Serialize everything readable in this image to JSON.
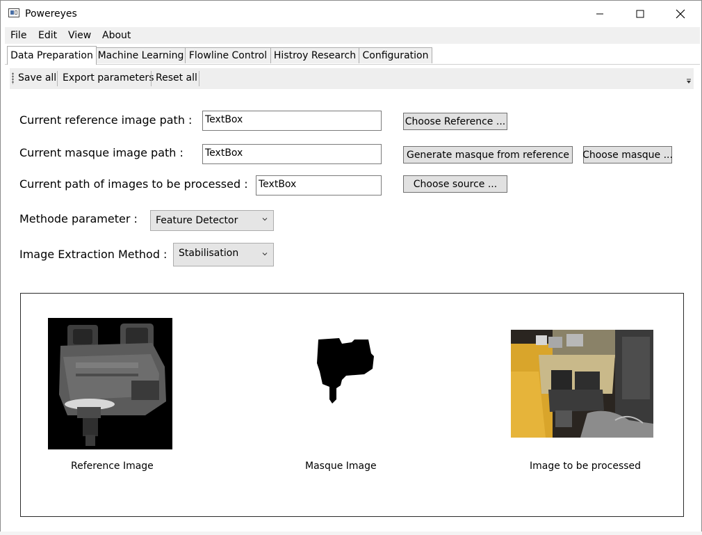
{
  "window": {
    "title": "Powereyes",
    "controls": [
      "minimize-icon",
      "maximize-icon",
      "close-icon"
    ]
  },
  "menu": {
    "items": [
      "File",
      "Edit",
      "View",
      "About"
    ]
  },
  "tabs": [
    {
      "label": "Data Preparation",
      "active": true
    },
    {
      "label": "Machine Learning",
      "active": false
    },
    {
      "label": "Flowline Control",
      "active": false
    },
    {
      "label": "Histroy Research",
      "active": false
    },
    {
      "label": "Configuration",
      "active": false
    }
  ],
  "toolbar": {
    "save_all": "Save all",
    "export_parameters": "Export parameters",
    "reset_all": "Reset all"
  },
  "form": {
    "reference_label": "Current reference image path :",
    "reference_value": "TextBox",
    "choose_reference_button": "Choose Reference ...",
    "masque_label": "Current masque image path :",
    "masque_value": "TextBox",
    "generate_masque_button": "Generate masque from reference",
    "choose_masque_button": "Choose masque ...",
    "source_label": "Current path of images to be processed :",
    "source_value": "TextBox",
    "choose_source_button": "Choose source ...",
    "methode_label": "Methode parameter :",
    "methode_selected": "Feature Detector",
    "extraction_label": "Image Extraction Method :",
    "extraction_selected": "Stabilisation"
  },
  "images": {
    "reference_caption": "Reference Image",
    "masque_caption": "Masque Image",
    "processed_caption": "Image to be processed"
  },
  "colors": {
    "menubar_bg": "#f0f0f0",
    "toolbar_bg": "#eeeeee",
    "button_bg": "#e1e1e1",
    "combo_bg": "#e5e5e5"
  }
}
